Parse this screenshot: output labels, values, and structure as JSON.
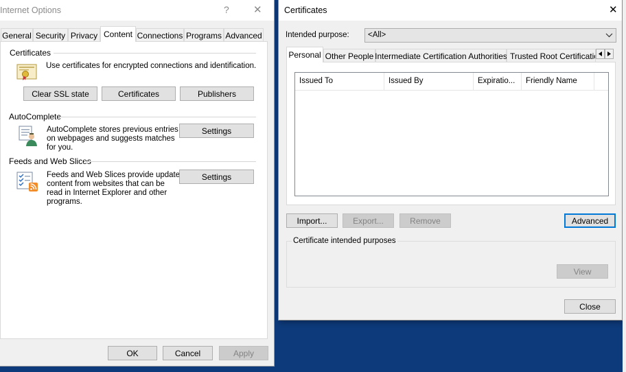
{
  "internet_options": {
    "title": "Internet Options",
    "help_glyph": "?",
    "close_glyph": "✕",
    "tabs": [
      "General",
      "Security",
      "Privacy",
      "Content",
      "Connections",
      "Programs",
      "Advanced"
    ],
    "active_tab": "Content",
    "certificates": {
      "heading": "Certificates",
      "description": "Use certificates for encrypted connections and identification.",
      "clear_ssl_label": "Clear SSL state",
      "certificates_label": "Certificates",
      "publishers_label": "Publishers"
    },
    "autocomplete": {
      "heading": "AutoComplete",
      "description_line1": "AutoComplete stores previous entries",
      "description_line2": "on webpages and suggests matches",
      "description_line3": "for you.",
      "settings_label": "Settings"
    },
    "feeds": {
      "heading": "Feeds and Web Slices",
      "description_line1": "Feeds and Web Slices provide updated",
      "description_line2": "content from websites that can be",
      "description_line3": "read in Internet Explorer and other",
      "description_line4": "programs.",
      "settings_label": "Settings"
    },
    "footer": {
      "ok_label": "OK",
      "cancel_label": "Cancel",
      "apply_label": "Apply"
    }
  },
  "certificates_dialog": {
    "title": "Certificates",
    "close_glyph": "✕",
    "purpose_label": "Intended purpose:",
    "purpose_value": "<All>",
    "tabs": [
      "Personal",
      "Other People",
      "Intermediate Certification Authorities",
      "Trusted Root Certification"
    ],
    "active_tab": "Personal",
    "columns": [
      "Issued To",
      "Issued By",
      "Expiratio...",
      "Friendly Name"
    ],
    "rows": [],
    "import_label": "Import...",
    "export_label": "Export...",
    "remove_label": "Remove",
    "advanced_label": "Advanced",
    "purposes_heading": "Certificate intended purposes",
    "view_label": "View",
    "close_label": "Close"
  },
  "colors": {
    "desktop": "#0d3a7a",
    "focus": "#0078d7"
  }
}
